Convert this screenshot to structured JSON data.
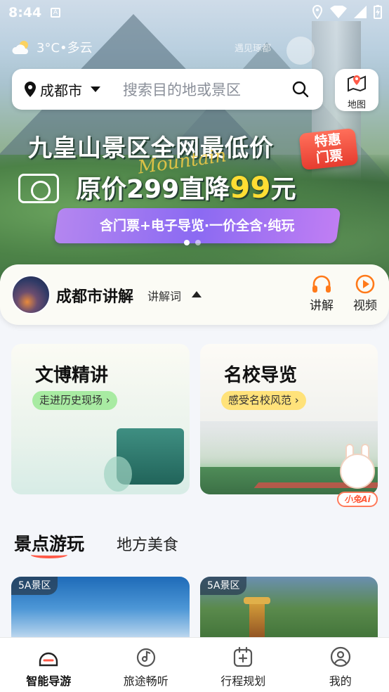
{
  "status_bar": {
    "time": "8:44"
  },
  "weather": {
    "text": "3°C•多云",
    "icon": "partly-cloudy-icon"
  },
  "watermark": "遇见琢都",
  "search": {
    "city": "成都市",
    "placeholder": "搜索目的地或景区"
  },
  "map_button": {
    "label": "地图"
  },
  "banner": {
    "line1": "九皇山景区全网最低价",
    "tag_line1": "特惠",
    "tag_line2": "门票",
    "script_word": "Mountain",
    "line2_prefix": "原价299直降",
    "line2_price": "99",
    "line2_suffix": "元",
    "ribbon": "含门票+电子导览·一价全含·纯玩",
    "active_slide": 1,
    "slide_count": 2
  },
  "explain": {
    "title": "成都市讲解",
    "subtitle": "讲解词",
    "actions": [
      {
        "label": "讲解",
        "icon": "headphones-icon"
      },
      {
        "label": "视频",
        "icon": "play-circle-icon"
      }
    ]
  },
  "features": [
    {
      "title": "文博精讲",
      "pill": "走进历史现场 ›"
    },
    {
      "title": "名校导览",
      "pill": "感受名校风范 ›"
    }
  ],
  "assistant": {
    "label": "小兔Ai"
  },
  "category_tabs": [
    {
      "label": "景点游玩",
      "active": true
    },
    {
      "label": "地方美食",
      "active": false
    }
  ],
  "scenic": [
    {
      "badge": "5A景区"
    },
    {
      "badge": "5A景区"
    }
  ],
  "bottom_nav": [
    {
      "label": "智能导游",
      "icon": "home-icon",
      "active": true
    },
    {
      "label": "旅途畅听",
      "icon": "music-disc-icon",
      "active": false
    },
    {
      "label": "行程规划",
      "icon": "calendar-plus-icon",
      "active": false
    },
    {
      "label": "我的",
      "icon": "user-icon",
      "active": false
    }
  ],
  "colors": {
    "accent": "#ff5a48",
    "brand_orange": "#ff7a1a",
    "ribbon": "#8b6af2",
    "price_yellow": "#ffdd33"
  }
}
